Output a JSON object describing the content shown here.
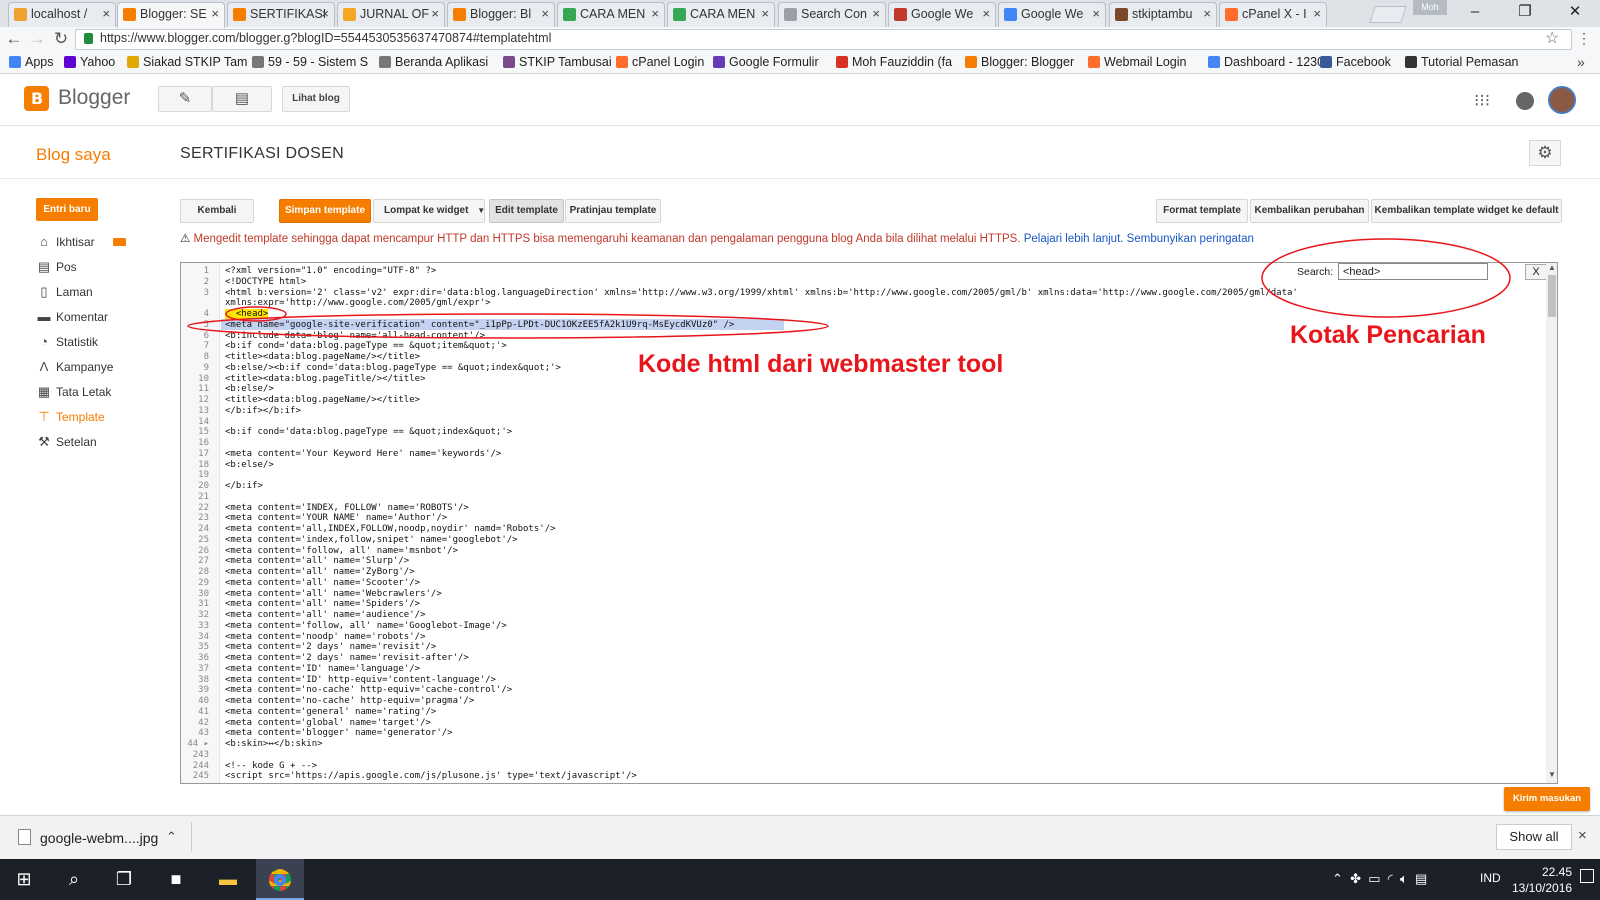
{
  "browser": {
    "tabs": [
      {
        "label": "localhost / ",
        "color": "#f0a030",
        "active": false
      },
      {
        "label": "Blogger: SE",
        "color": "#f57d00",
        "active": true
      },
      {
        "label": "SERTIFIKASI",
        "color": "#f57d00",
        "active": false
      },
      {
        "label": "JURNAL OF",
        "color": "#f5a623",
        "active": false
      },
      {
        "label": "Blogger: Bl",
        "color": "#f57d00",
        "active": false
      },
      {
        "label": "CARA MEN",
        "color": "#34a853",
        "active": false
      },
      {
        "label": "CARA MEN",
        "color": "#34a853",
        "active": false
      },
      {
        "label": "Search Con",
        "color": "#9aa0a6",
        "active": false
      },
      {
        "label": "Google We",
        "color": "#c0392b",
        "active": false
      },
      {
        "label": "Google We",
        "color": "#4285f4",
        "active": false
      },
      {
        "label": "stkiptambu",
        "color": "#7a4a2a",
        "active": false
      },
      {
        "label": "cPanel X - I",
        "color": "#ff6c2c",
        "active": false
      }
    ],
    "tab_close": "×",
    "profile_label": "Moh",
    "url": "https://www.blogger.com/blogger.g?blogID=5544530535637470874#templatehtml",
    "bookmarks": [
      {
        "label": "Apps",
        "color": "#4285f4"
      },
      {
        "label": "Yahoo",
        "color": "#5f01d1"
      },
      {
        "label": "Siakad STKIP Tam",
        "color": "#e0a800"
      },
      {
        "label": "59 - 59 - Sistem S",
        "color": "#777777"
      },
      {
        "label": "Beranda Aplikasi",
        "color": "#777777"
      },
      {
        "label": "STKIP Tambusai",
        "color": "#7a4a8a"
      },
      {
        "label": "cPanel Login",
        "color": "#ff6c2c"
      },
      {
        "label": "Google Formulir",
        "color": "#673ab7"
      },
      {
        "label": "Moh Fauziddin (fa",
        "color": "#d93025"
      },
      {
        "label": "Blogger: Blogger",
        "color": "#f57d00"
      },
      {
        "label": "Webmail Login",
        "color": "#ff6c2c"
      },
      {
        "label": "Dashboard - 1230",
        "color": "#4285f4"
      },
      {
        "label": "Facebook",
        "color": "#3b5998"
      },
      {
        "label": "Tutorial Pemasan",
        "color": "#333333"
      }
    ],
    "more_bookmarks": "»"
  },
  "blogger": {
    "logo_letter": "B",
    "name": "Blogger",
    "view_blog": "Lihat blog",
    "my_blogs": "Blog saya",
    "blog_title": "SERTIFIKASI DOSEN",
    "accent": "#f57d00"
  },
  "sidebar": {
    "new_post": "Entri baru",
    "items": [
      {
        "label": "Ikhtisar",
        "icon": "home-icon",
        "glyph": "⌂",
        "selected": false
      },
      {
        "label": "Pos",
        "icon": "posts-icon",
        "glyph": "▤",
        "selected": false
      },
      {
        "label": "Laman",
        "icon": "pages-icon",
        "glyph": "▯",
        "selected": false
      },
      {
        "label": "Komentar",
        "icon": "comment-icon",
        "glyph": "▬",
        "selected": false
      },
      {
        "label": "Statistik",
        "icon": "stats-icon",
        "glyph": "◔",
        "selected": false
      },
      {
        "label": "Kampanye",
        "icon": "campaign-icon",
        "glyph": "Λ",
        "selected": false
      },
      {
        "label": "Tata Letak",
        "icon": "layout-icon",
        "glyph": "▦",
        "selected": false
      },
      {
        "label": "Template",
        "icon": "template-icon",
        "glyph": "⊤",
        "selected": true
      },
      {
        "label": "Setelan",
        "icon": "wrench-icon",
        "glyph": "⚒",
        "selected": false
      }
    ]
  },
  "toolbar": {
    "back": "Kembali",
    "save": "Simpan template",
    "jump": "Lompat ke widget",
    "edit": "Edit template",
    "preview": "Pratinjau template",
    "format": "Format template",
    "revert": "Kembalikan perubahan",
    "revert_widgets": "Kembalikan template widget ke default"
  },
  "warning": {
    "text": "Mengedit template sehingga dapat mencampur HTTP dan HTTPS bisa memengaruhi keamanan dan pengalaman pengguna blog Anda bila dilihat melalui HTTPS.",
    "learn_more": "Pelajari lebih lanjut.",
    "hide": "Sembunyikan peringatan"
  },
  "search": {
    "label": "Search:",
    "value": "<head>",
    "close": "X"
  },
  "code_lines": [
    {
      "n": "1",
      "text": "<?xml version=\"1.0\" encoding=\"UTF-8\" ?>"
    },
    {
      "n": "2",
      "text": "<!DOCTYPE html>"
    },
    {
      "n": "3",
      "text": "<html b:version='2' class='v2' expr:dir='data:blog.languageDirection' xmlns='http://www.w3.org/1999/xhtml' xmlns:b='http://www.google.com/2005/gml/b' xmlns:data='http://www.google.com/2005/gml/data'"
    },
    {
      "n": "",
      "text": "xmlns:expr='http://www.google.com/2005/gml/expr'>"
    },
    {
      "n": "4",
      "text": "  <head>"
    },
    {
      "n": "5",
      "text": "<meta name=\"google-site-verification\" content=\"_i1pPp-LPDt-DUC1OKzEE5fA2k1U9rq-MsEycdKVUz0\" />"
    },
    {
      "n": "6",
      "text": "<b:include data='blog' name='all-head-content'/>"
    },
    {
      "n": "7",
      "text": "<b:if cond='data:blog.pageType == &quot;item&quot;'>"
    },
    {
      "n": "8",
      "text": "<title><data:blog.pageName/></title>"
    },
    {
      "n": "9",
      "text": "<b:else/><b:if cond='data:blog.pageType == &quot;index&quot;'>"
    },
    {
      "n": "10",
      "text": "<title><data:blog.pageTitle/></title>"
    },
    {
      "n": "11",
      "text": "<b:else/>"
    },
    {
      "n": "12",
      "text": "<title><data:blog.pageName/></title>"
    },
    {
      "n": "13",
      "text": "</b:if></b:if>"
    },
    {
      "n": "14",
      "text": ""
    },
    {
      "n": "15",
      "text": "<b:if cond='data:blog.pageType == &quot;index&quot;'>"
    },
    {
      "n": "16",
      "text": ""
    },
    {
      "n": "17",
      "text": "<meta content='Your Keyword Here' name='keywords'/>"
    },
    {
      "n": "18",
      "text": "<b:else/>"
    },
    {
      "n": "19",
      "text": ""
    },
    {
      "n": "20",
      "text": "</b:if>"
    },
    {
      "n": "21",
      "text": ""
    },
    {
      "n": "22",
      "text": "<meta content='INDEX, FOLLOW' name='ROBOTS'/>"
    },
    {
      "n": "23",
      "text": "<meta content='YOUR NAME' name='Author'/>"
    },
    {
      "n": "24",
      "text": "<meta content='all,INDEX,FOLLOW,noodp,noydir' namd='Robots'/>"
    },
    {
      "n": "25",
      "text": "<meta content='index,follow,snipet' name='googlebot'/>"
    },
    {
      "n": "26",
      "text": "<meta content='follow, all' name='msnbot'/>"
    },
    {
      "n": "27",
      "text": "<meta content='all' name='Slurp'/>"
    },
    {
      "n": "28",
      "text": "<meta content='all' name='ZyBorg'/>"
    },
    {
      "n": "29",
      "text": "<meta content='all' name='Scooter'/>"
    },
    {
      "n": "30",
      "text": "<meta content='all' name='Webcrawlers'/>"
    },
    {
      "n": "31",
      "text": "<meta content='all' name='Spiders'/>"
    },
    {
      "n": "32",
      "text": "<meta content='all' name='audience'/>"
    },
    {
      "n": "33",
      "text": "<meta content='follow, all' name='Googlebot-Image'/>"
    },
    {
      "n": "34",
      "text": "<meta content='noodp' name='robots'/>"
    },
    {
      "n": "35",
      "text": "<meta content='2 days' name='revisit'/>"
    },
    {
      "n": "36",
      "text": "<meta content='2 days' name='revisit-after'/>"
    },
    {
      "n": "37",
      "text": "<meta content='ID' name='language'/>"
    },
    {
      "n": "38",
      "text": "<meta content='ID' http-equiv='content-language'/>"
    },
    {
      "n": "39",
      "text": "<meta content='no-cache' http-equiv='cache-control'/>"
    },
    {
      "n": "40",
      "text": "<meta content='no-cache' http-equiv='pragma'/>"
    },
    {
      "n": "41",
      "text": "<meta content='general' name='rating'/>"
    },
    {
      "n": "42",
      "text": "<meta content='global' name='target'/>"
    },
    {
      "n": "43",
      "text": "<meta content='blogger' name='generator'/>"
    },
    {
      "n": "44 ▸",
      "text": "<b:skin>↔</b:skin>"
    },
    {
      "n": "243",
      "text": ""
    },
    {
      "n": "244",
      "text": "<!-- kode G + -->"
    },
    {
      "n": "245",
      "text": "<script src='https://apis.google.com/js/plusone.js' type='text/javascript'/>"
    }
  ],
  "annotations": {
    "search_box": "Kotak Pencarian",
    "html_code": "Kode html dari webmaster tool",
    "color": "#e8151b"
  },
  "feedback": "Kirim masukan",
  "downloads": {
    "file": "google-webm....jpg",
    "show_all": "Show all",
    "close": "×"
  },
  "taskbar": {
    "language": "IND",
    "time": "22.45",
    "date": "13/10/2016"
  }
}
